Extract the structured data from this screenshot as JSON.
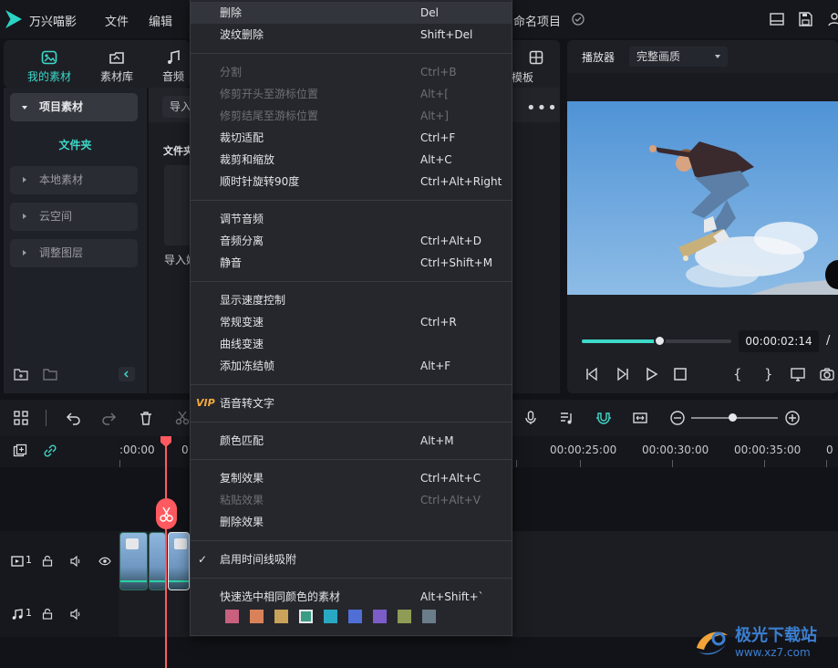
{
  "app": {
    "name": "万兴喵影",
    "menus": [
      "文件",
      "编辑"
    ],
    "project_name": "命名项目"
  },
  "media_tabs": [
    {
      "label": "我的素材",
      "icon": "folder-media-icon",
      "active": true
    },
    {
      "label": "素材库",
      "icon": "cloud-library-icon"
    },
    {
      "label": "音频",
      "icon": "music-note-icon"
    },
    {
      "label": "模板",
      "icon": "template-icon"
    }
  ],
  "sidebar": {
    "items": [
      {
        "label": "项目素材",
        "active": true
      },
      {
        "label": "本地素材"
      },
      {
        "label": "云空间"
      },
      {
        "label": "调整图层"
      }
    ],
    "folder_label": "文件夹"
  },
  "media": {
    "import_label": "导入",
    "folder_header": "文件夹",
    "import_hint": "导入媒"
  },
  "player": {
    "title": "播放器",
    "quality": "完整画质",
    "timecode": "00:00:02:14",
    "slash": "/",
    "progress_fraction": 0.52
  },
  "timeline": {
    "ruler_labels": [
      ":00:00",
      "0",
      "00:00:25:00",
      "00:00:30:00",
      "00:00:35:00"
    ],
    "video_track_num": "1",
    "audio_track_num": "1"
  },
  "context_menu": {
    "groups": [
      [
        {
          "label": "删除",
          "shortcut": "Del",
          "highlight": true
        },
        {
          "label": "波纹删除",
          "shortcut": "Shift+Del"
        }
      ],
      [
        {
          "label": "分割",
          "shortcut": "Ctrl+B",
          "disabled": true
        },
        {
          "label": "修剪开头至游标位置",
          "shortcut": "Alt+[",
          "disabled": true
        },
        {
          "label": "修剪结尾至游标位置",
          "shortcut": "Alt+]",
          "disabled": true
        },
        {
          "label": "裁切适配",
          "shortcut": "Ctrl+F"
        },
        {
          "label": "裁剪和缩放",
          "shortcut": "Alt+C"
        },
        {
          "label": "顺时针旋转90度",
          "shortcut": "Ctrl+Alt+Right"
        }
      ],
      [
        {
          "label": "调节音频",
          "shortcut": ""
        },
        {
          "label": "音频分离",
          "shortcut": "Ctrl+Alt+D"
        },
        {
          "label": "静音",
          "shortcut": "Ctrl+Shift+M"
        }
      ],
      [
        {
          "label": "显示速度控制",
          "shortcut": ""
        },
        {
          "label": "常规变速",
          "shortcut": "Ctrl+R"
        },
        {
          "label": "曲线变速",
          "shortcut": ""
        },
        {
          "label": "添加冻结帧",
          "shortcut": "Alt+F"
        }
      ],
      [
        {
          "label": "语音转文字",
          "shortcut": "",
          "badge": "VIP"
        }
      ],
      [
        {
          "label": "颜色匹配",
          "shortcut": "Alt+M"
        }
      ],
      [
        {
          "label": "复制效果",
          "shortcut": "Ctrl+Alt+C"
        },
        {
          "label": "粘贴效果",
          "shortcut": "Ctrl+Alt+V",
          "disabled": true
        },
        {
          "label": "删除效果",
          "shortcut": ""
        }
      ],
      [
        {
          "label": "启用时间线吸附",
          "shortcut": "",
          "checked": true
        }
      ],
      [
        {
          "label": "快速选中相同颜色的素材",
          "shortcut": "Alt+Shift+`"
        }
      ]
    ],
    "swatches": [
      "#c8607e",
      "#d9825a",
      "#c9a35a",
      "#3a9c84",
      "#28a8c3",
      "#4f6fd6",
      "#7c5cc9",
      "#8f9c56",
      "#6b7c8a"
    ],
    "selected_swatch": 3
  },
  "watermark": {
    "text": "极光下载站",
    "url": "www.xz7.com"
  }
}
